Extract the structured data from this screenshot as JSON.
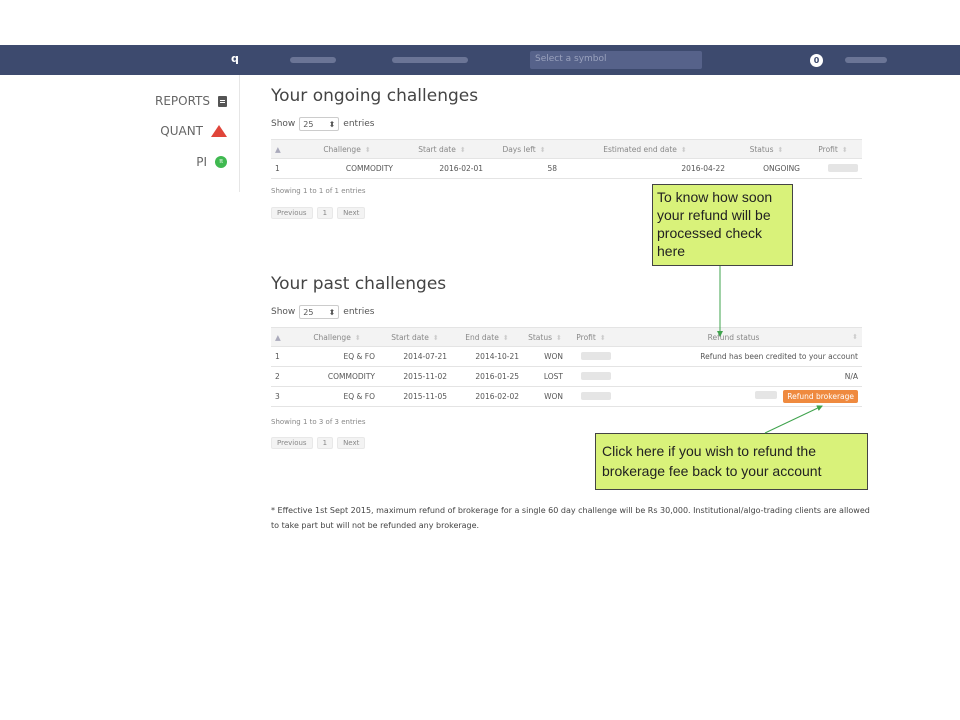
{
  "nav": {
    "logo": "q",
    "search_placeholder": "Select a symbol",
    "badge": "0"
  },
  "sidebar": {
    "items": [
      {
        "label": "REPORTS",
        "icon": "document-icon"
      },
      {
        "label": "QUANT",
        "icon": "quant-icon"
      },
      {
        "label": "PI",
        "icon": "pi-icon"
      }
    ]
  },
  "ongoing": {
    "title": "Your ongoing challenges",
    "show_label": "Show",
    "show_value": "25",
    "entries_label": "entries",
    "columns": [
      "Challenge",
      "Start date",
      "Days left",
      "Estimated end date",
      "Status",
      "Profit"
    ],
    "rows": [
      {
        "idx": "1",
        "challenge": "COMMODITY",
        "start": "2016-02-01",
        "days_left": "58",
        "end": "2016-04-22",
        "status": "ONGOING"
      }
    ],
    "showing": "Showing 1 to 1 of 1 entries",
    "pager": {
      "prev": "Previous",
      "page": "1",
      "next": "Next"
    }
  },
  "past": {
    "title": "Your past challenges",
    "show_label": "Show",
    "show_value": "25",
    "entries_label": "entries",
    "columns": [
      "Challenge",
      "Start date",
      "End date",
      "Status",
      "Profit",
      "Refund status"
    ],
    "rows": [
      {
        "idx": "1",
        "challenge": "EQ & FO",
        "start": "2014-07-21",
        "end": "2014-10-21",
        "status": "WON",
        "refund": "Refund has been credited to your account"
      },
      {
        "idx": "2",
        "challenge": "COMMODITY",
        "start": "2015-11-02",
        "end": "2016-01-25",
        "status": "LOST",
        "refund": "N/A"
      },
      {
        "idx": "3",
        "challenge": "EQ & FO",
        "start": "2015-11-05",
        "end": "2016-02-02",
        "status": "WON",
        "refund": ""
      }
    ],
    "refund_button": "Refund brokerage",
    "showing": "Showing 1 to 3 of 3 entries",
    "pager": {
      "prev": "Previous",
      "page": "1",
      "next": "Next"
    }
  },
  "callouts": {
    "refund_status": "To know how soon your refund will be processed check here",
    "refund_button": "Click here if you wish to refund the brokerage fee back to your account"
  },
  "footnote": "* Effective 1st Sept 2015, maximum refund of brokerage for a single 60 day challenge will be Rs 30,000. Institutional/algo-trading clients are allowed to take part but will not be refunded any brokerage.",
  "colors": {
    "navbar": "#3d4a6e",
    "refund_button": "#ef8a3f",
    "callout": "#d9f27a"
  }
}
